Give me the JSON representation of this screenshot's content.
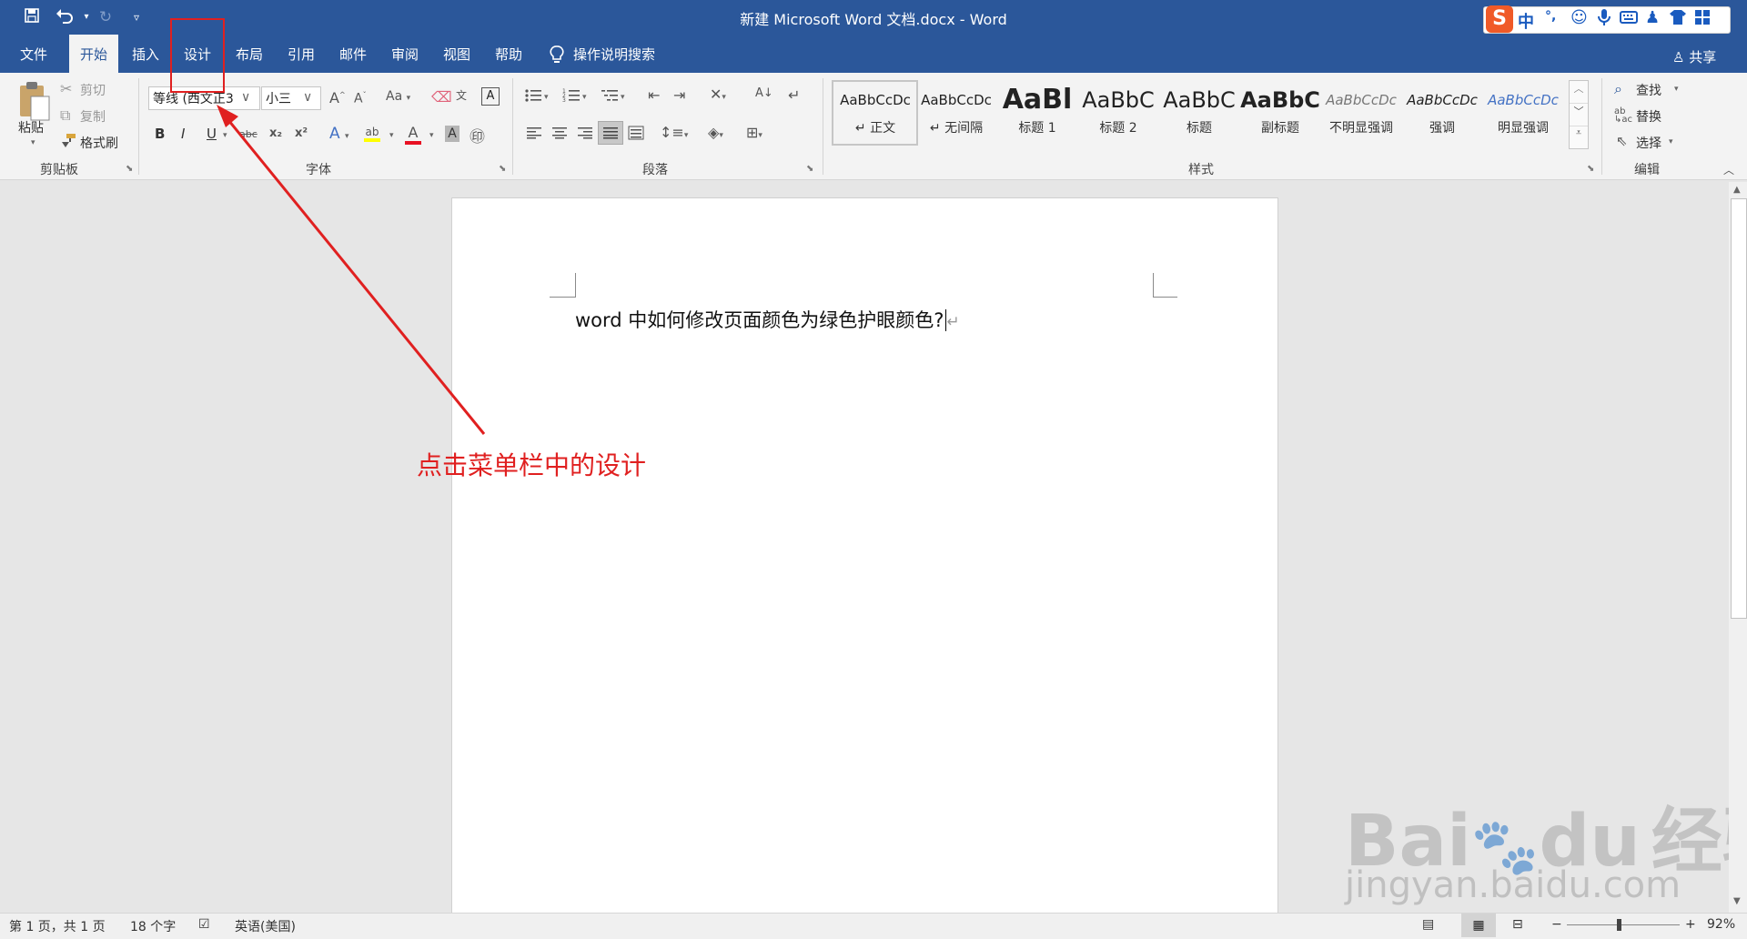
{
  "window": {
    "title": "新建 Microsoft Word 文档.docx  -  Word",
    "share_label": "共享",
    "close_glyph": "✕"
  },
  "quick_access": {
    "save_icon": "save-icon",
    "undo_icon": "undo-icon",
    "redo_icon": "redo-icon",
    "customize_icon": "customize-icon"
  },
  "tabs": [
    "文件",
    "开始",
    "插入",
    "设计",
    "布局",
    "引用",
    "邮件",
    "审阅",
    "视图",
    "帮助"
  ],
  "active_tab": "开始",
  "tell_me": "操作说明搜索",
  "ime": {
    "logo": "S",
    "mode": "中",
    "punct": "°,"
  },
  "clipboard": {
    "paste": "粘贴",
    "cut": "剪切",
    "copy": "复制",
    "format_painter": "格式刷",
    "group": "剪贴板"
  },
  "font": {
    "name": "等线 (西文正3",
    "size": "小三",
    "grow": "A",
    "shrink": "A",
    "change_case": "Aa",
    "bold": "B",
    "italic": "I",
    "underline": "U",
    "strike": "abc",
    "subscript": "x₂",
    "superscript": "x²",
    "effects": "A",
    "highlight": "ab",
    "color": "A",
    "shade": "A",
    "group": "字体"
  },
  "paragraph": {
    "group": "段落"
  },
  "styles": {
    "items": [
      {
        "preview": "AaBbCcDc",
        "name": "↵ 正文"
      },
      {
        "preview": "AaBbCcDc",
        "name": "↵ 无间隔"
      },
      {
        "preview": "AaBl",
        "name": "标题 1"
      },
      {
        "preview": "AaBbC",
        "name": "标题 2"
      },
      {
        "preview": "AaBbC",
        "name": "标题"
      },
      {
        "preview": "AaBbC",
        "name": "副标题"
      },
      {
        "preview": "AaBbCcDc",
        "name": "不明显强调"
      },
      {
        "preview": "AaBbCcDc",
        "name": "强调"
      },
      {
        "preview": "AaBbCcDc",
        "name": "明显强调"
      }
    ],
    "group": "样式"
  },
  "editing": {
    "find": "查找",
    "replace": "替换",
    "select": "选择",
    "group": "编辑"
  },
  "document": {
    "text": "word 中如何修改页面颜色为绿色护眼颜色?",
    "annotation": "点击菜单栏中的设计"
  },
  "status": {
    "page": "第 1 页，共 1 页",
    "words": "18 个字",
    "language": "英语(美国)",
    "zoom": "92%",
    "zoom_minus": "−",
    "zoom_plus": "+"
  },
  "watermark": {
    "brand": "Bai",
    "brand2": "du",
    "cn": "经验",
    "url": "jingyan.baidu.com"
  },
  "colors": {
    "accent": "#2b579a",
    "annotation": "#e02020"
  }
}
